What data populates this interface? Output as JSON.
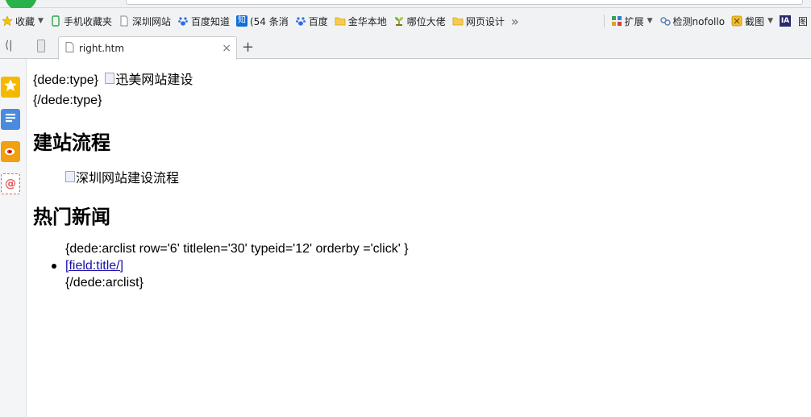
{
  "browser": {
    "bookmarks": [
      {
        "label": "收藏",
        "icon": "star-icon"
      },
      {
        "label": "手机收藏夹",
        "icon": "phone-icon"
      },
      {
        "label": "深圳网站",
        "icon": "page-icon"
      },
      {
        "label": "百度知道",
        "icon": "paw-icon"
      },
      {
        "label": "(54 条消",
        "icon": "zhihu-icon",
        "badge": "知"
      },
      {
        "label": "百度",
        "icon": "paw-icon"
      },
      {
        "label": "金华本地",
        "icon": "folder-icon"
      },
      {
        "label": "哪位大佬",
        "icon": "plant-icon"
      },
      {
        "label": "网页设计",
        "icon": "folder-icon"
      },
      {
        "label": "»",
        "icon": "more-icon"
      },
      {
        "label": "扩展",
        "icon": "extension-icon"
      },
      {
        "label": "检测nofollo",
        "icon": "link-icon"
      },
      {
        "label": "截图",
        "icon": "screenshot-icon"
      },
      {
        "label": "IA",
        "icon": "ia-icon"
      },
      {
        "label": "图",
        "icon": "image-icon"
      }
    ],
    "tab": {
      "title": "right.htm",
      "close": "×"
    },
    "new_tab": "+",
    "back_glyph": "⟨|"
  },
  "page": {
    "type_open": "{dede:type}",
    "type_img_alt": "迅美网站建设",
    "type_close": "{/dede:type}",
    "heading1": "建站流程",
    "process_img_alt": "深圳网站建设流程",
    "heading2": "热门新闻",
    "arclist_open": "{dede:arclist row='6' titlelen='30' typeid='12' orderby ='click' }",
    "link_text": "[field:title/]",
    "arclist_close": "{/dede:arclist}"
  }
}
